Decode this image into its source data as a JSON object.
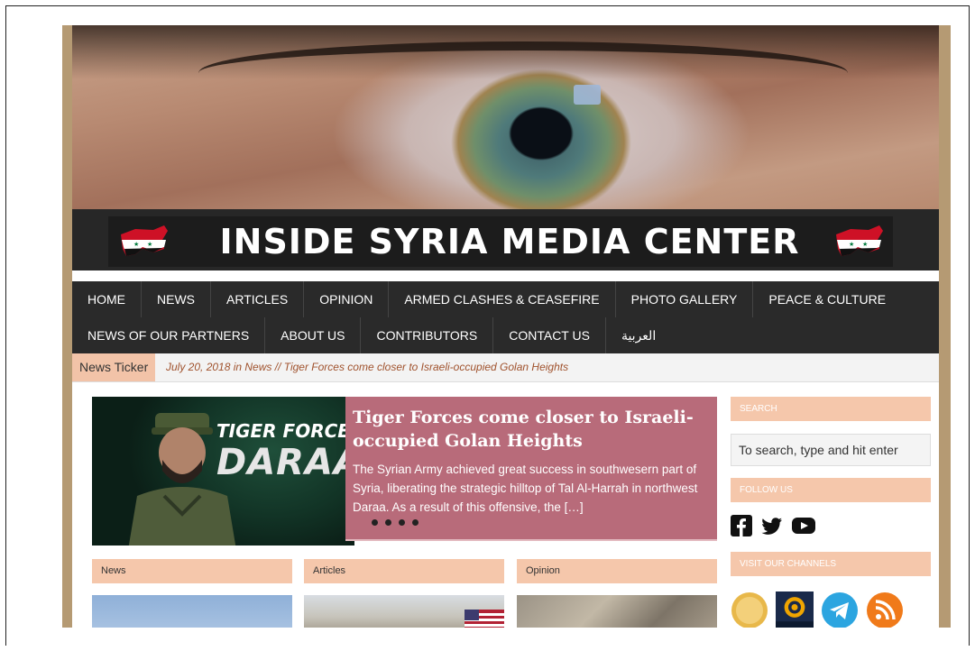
{
  "site": {
    "banner_title": "INSIDE SYRIA MEDIA CENTER"
  },
  "nav": {
    "row1": [
      "HOME",
      "NEWS",
      "ARTICLES",
      "OPINION",
      "ARMED CLASHES & CEASEFIRE",
      "PHOTO GALLERY",
      "PEACE & CULTURE"
    ],
    "row2": [
      "NEWS OF OUR PARTNERS",
      "ABOUT US",
      "CONTRIBUTORS",
      "CONTACT US",
      "العربية"
    ]
  },
  "ticker": {
    "label": "News Ticker",
    "text": "July 20, 2018 in News // Tiger Forces come closer to Israeli-occupied Golan Heights"
  },
  "feature": {
    "image_line1": "TIGER FORCES",
    "image_line2": "DARAA",
    "title": "Tiger Forces come closer to Israeli-occupied Golan Heights",
    "excerpt": "The Syrian Army achieved great success in southwesern part of Syria, liberating the strategic hilltop of Tal Al-Harrah in northwest Daraa. As a result of this offensive, the […]"
  },
  "categories": [
    "News",
    "Articles",
    "Opinion"
  ],
  "sidebar": {
    "search_heading": "SEARCH",
    "search_placeholder": "To search, type and hit enter",
    "follow_heading": "FOLLOW US",
    "channels_heading": "VISIT OUR CHANNELS",
    "social_icons": [
      "facebook-icon",
      "twitter-icon",
      "youtube-icon"
    ],
    "channel_icons": [
      "channel-badge-icon",
      "news360-icon",
      "telegram-icon",
      "rss-icon"
    ]
  },
  "colors": {
    "nav_bg": "#2a2a2a",
    "accent_peach": "#f5c7ab",
    "feature_bg": "#b86b7a",
    "ticker_text": "#a0522d",
    "frame_tan": "#b59a73"
  }
}
